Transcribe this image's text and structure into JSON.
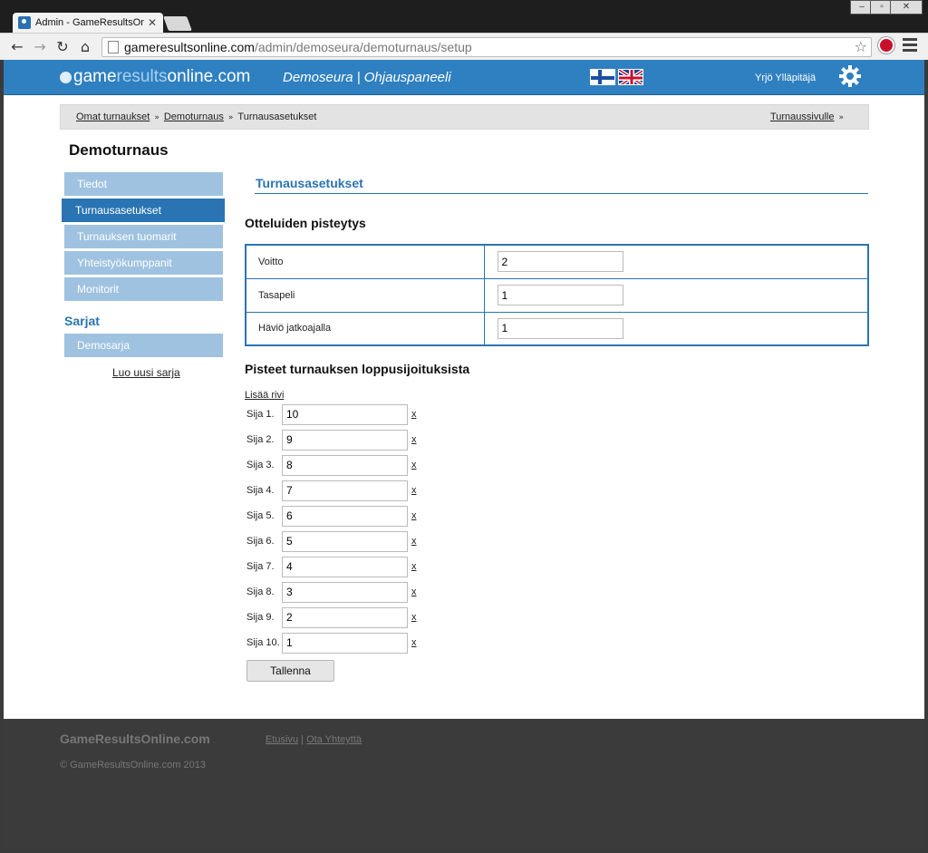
{
  "browser": {
    "tab_title": "Admin - GameResultsOnli",
    "url_host": "gameresultsonline.com",
    "url_path": "/admin/demoseura/demoturnaus/setup"
  },
  "header": {
    "logo_part1": "game",
    "logo_part2": "results",
    "logo_part3": "online.com",
    "context": "Demoseura | Ohjauspaneeli",
    "user": "Yrjö Ylläpitäjä",
    "brand_color": "#2f80c0"
  },
  "breadcrumb": {
    "items": [
      "Omat turnaukset",
      "Demoturnaus",
      "Turnausasetukset"
    ],
    "right_link": "Turnaussivulle"
  },
  "page_title": "Demoturnaus",
  "sidebar": {
    "items": [
      {
        "label": "Tiedot"
      },
      {
        "label": "Turnausasetukset"
      },
      {
        "label": "Turnauksen tuomarit"
      },
      {
        "label": "Yhteistyökumppanit"
      },
      {
        "label": "Monitorit"
      }
    ],
    "series_heading": "Sarjat",
    "series": [
      {
        "label": "Demosarja"
      }
    ],
    "new_series": "Luo uusi sarja"
  },
  "main": {
    "section_title": "Turnausasetukset",
    "match_scoring_heading": "Otteluiden pisteytys",
    "match_scoring": [
      {
        "label": "Voitto",
        "value": "2"
      },
      {
        "label": "Tasapeli",
        "value": "1"
      },
      {
        "label": "Häviö jatkoajalla",
        "value": "1"
      }
    ],
    "placement_heading": "Pisteet turnauksen loppusijoituksista",
    "add_row": "Lisää rivi",
    "remove_label": "x",
    "placements": [
      {
        "label": "Sija 1.",
        "value": "10"
      },
      {
        "label": "Sija 2.",
        "value": "9"
      },
      {
        "label": "Sija 3.",
        "value": "8"
      },
      {
        "label": "Sija 4.",
        "value": "7"
      },
      {
        "label": "Sija 5.",
        "value": "6"
      },
      {
        "label": "Sija 6.",
        "value": "5"
      },
      {
        "label": "Sija 7.",
        "value": "4"
      },
      {
        "label": "Sija 8.",
        "value": "3"
      },
      {
        "label": "Sija 9.",
        "value": "2"
      },
      {
        "label": "Sija 10.",
        "value": "1"
      }
    ],
    "save_label": "Tallenna"
  },
  "footer": {
    "brand": "GameResultsOnline.com",
    "link_home": "Etusivu",
    "link_separator": "|",
    "link_contact": "Ota Yhteyttä",
    "copyright": "© GameResultsOnline.com 2013"
  }
}
